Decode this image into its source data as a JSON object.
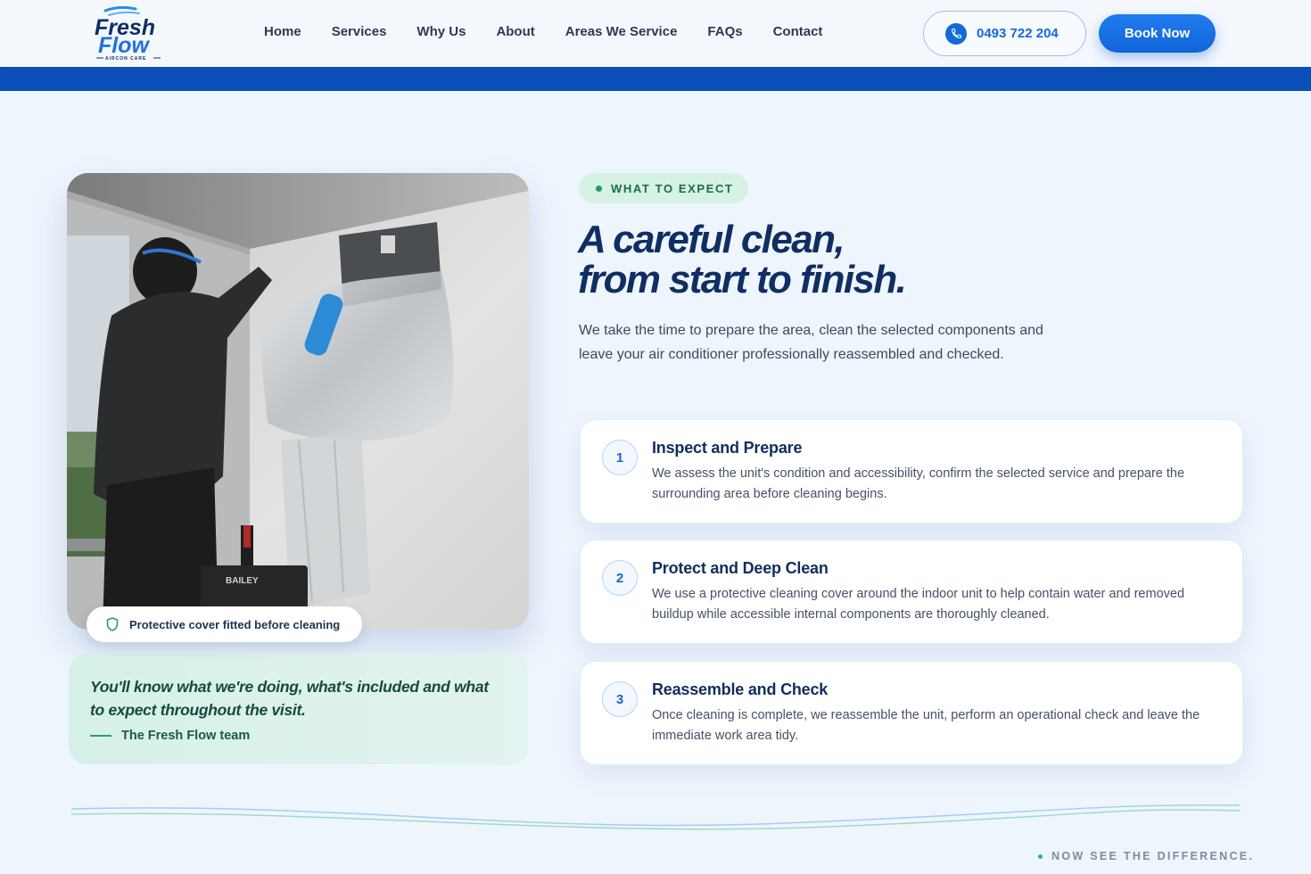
{
  "brand": {
    "logo_line1": "Fresh",
    "logo_line2": "Flow",
    "logo_tagline": "AIRCON CARE"
  },
  "nav": {
    "items": [
      "Home",
      "Services",
      "Why Us",
      "About",
      "Areas We Service",
      "FAQs",
      "Contact"
    ]
  },
  "header": {
    "phone": "0493 722 204",
    "phone_icon": "phone-icon",
    "book_label": "Book Now"
  },
  "photo": {
    "caption": "Protective cover fitted before cleaning",
    "caption_icon": "shield-icon",
    "tool_label": "BAILEY"
  },
  "quote": {
    "text": "You'll know what we're doing, what's included and what to expect throughout the visit.",
    "author": "The Fresh Flow team"
  },
  "section": {
    "eyebrow": "WHAT TO EXPECT",
    "headline_line1": "A careful clean,",
    "headline_line2": "from start to finish.",
    "lead": "We take the time to prepare the area, clean the selected components and leave your air conditioner professionally reassembled and checked."
  },
  "steps": [
    {
      "number": "1",
      "title": "Inspect and Prepare",
      "text": "We assess the unit's condition and accessibility, confirm the selected service and prepare the surrounding area before cleaning begins."
    },
    {
      "number": "2",
      "title": "Protect and Deep Clean",
      "text": "We use a protective cleaning cover around the indoor unit to help contain water and removed buildup while accessible internal components are thoroughly cleaned."
    },
    {
      "number": "3",
      "title": "Reassemble and Check",
      "text": "Once cleaning is complete, we reassemble the unit, perform an operational check and leave the immediate work area tidy."
    }
  ],
  "next_section": {
    "eyebrow": "NOW SEE THE DIFFERENCE."
  },
  "colors": {
    "primary_blue": "#1469d8",
    "navy": "#102e63",
    "green_accent": "#1f9e6d",
    "band_blue": "#0b4fb8"
  }
}
